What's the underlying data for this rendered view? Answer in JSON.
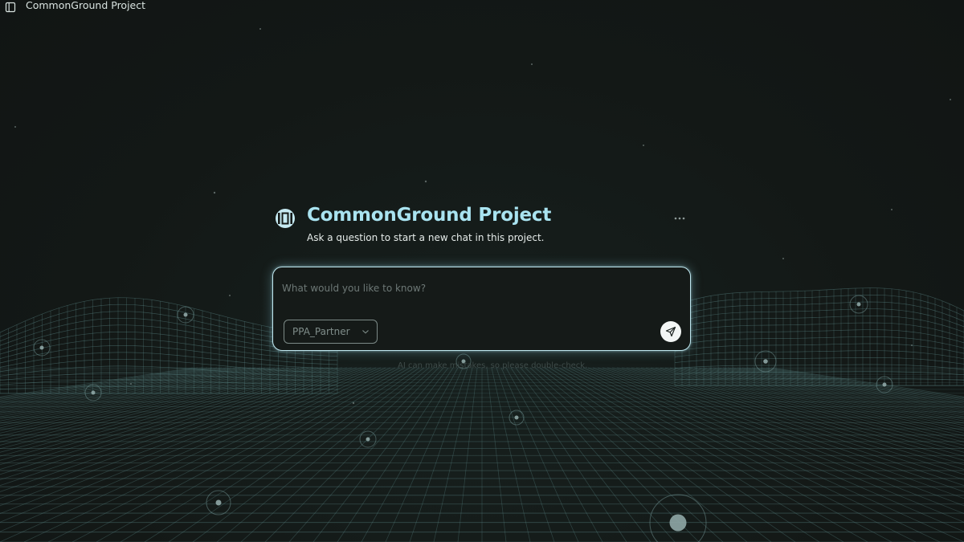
{
  "topbar": {
    "title": "CommonGround Project",
    "toggle_icon": "sidebar-toggle-icon"
  },
  "project": {
    "title": "CommonGround Project",
    "subtitle": "Ask a question to start a new chat in this project.",
    "icon": "project-icon"
  },
  "chat": {
    "placeholder": "What would you like to know?",
    "model_selected": "PPA_Partner",
    "send_icon": "send-icon"
  },
  "disclaimer": "AI can make mistakes, so please double-check.",
  "colors": {
    "accent": "#a9e3f0",
    "background": "#141917",
    "border": "#bfe7ef",
    "grid": "#5f8e8f"
  }
}
